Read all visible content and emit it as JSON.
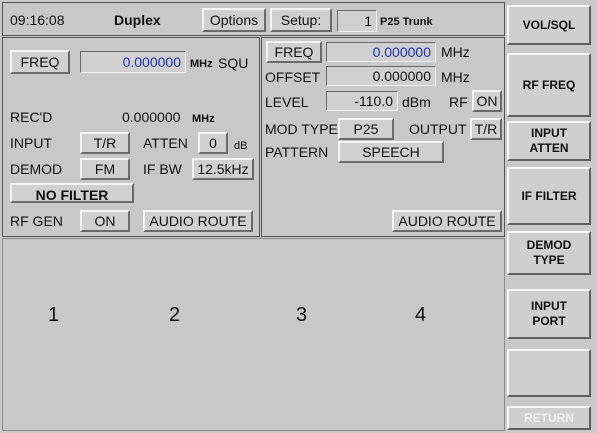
{
  "topbar": {
    "time": "09:16:08",
    "mode": "Duplex",
    "options": "Options",
    "setup_label": "Setup:",
    "setup_index": "1",
    "setup_name": "P25 Trunk"
  },
  "receiver": {
    "freq_button": "FREQ",
    "freq_value": "0.000000",
    "freq_unit": "MHz",
    "squelch": "SQU",
    "recd_label": "REC'D",
    "recd_value": "0.000000",
    "recd_unit": "MHz",
    "input_label": "INPUT",
    "input_value": "T/R",
    "atten_label": "ATTEN",
    "atten_value": "0",
    "atten_unit": "dB",
    "demod_label": "DEMOD",
    "demod_value": "FM",
    "ifbw_label": "IF BW",
    "ifbw_value": "12.5kHz",
    "filter_button": "NO FILTER",
    "rfgen_label": "RF GEN",
    "rfgen_value": "ON",
    "audio_route": "AUDIO ROUTE"
  },
  "generator": {
    "freq_button": "FREQ",
    "freq_value": "0.000000",
    "freq_unit": "MHz",
    "offset_label": "OFFSET",
    "offset_value": "0.000000",
    "offset_unit": "MHz",
    "level_label": "LEVEL",
    "level_value": "-110.0",
    "level_unit": "dBm",
    "rf_label": "RF",
    "rf_value": "ON",
    "modtype_label": "MOD TYPE",
    "modtype_value": "P25",
    "output_label": "OUTPUT",
    "output_value": "T/R",
    "pattern_label": "PATTERN",
    "pattern_value": "SPEECH",
    "audio_route": "AUDIO ROUTE"
  },
  "lower_numbers": [
    "1",
    "2",
    "3",
    "4"
  ],
  "softkeys": [
    {
      "label": "VOL/SQL",
      "enabled": true
    },
    {
      "label": "RF FREQ",
      "enabled": true
    },
    {
      "label": "INPUT\nATTEN",
      "enabled": true
    },
    {
      "label": "IF FILTER",
      "enabled": true
    },
    {
      "label": "DEMOD\nTYPE",
      "enabled": true
    },
    {
      "label": "INPUT\nPORT",
      "enabled": true
    },
    {
      "label": "",
      "enabled": true
    },
    {
      "label": "RETURN",
      "enabled": false
    }
  ],
  "colors": {
    "screen_bg": "#c8c8c8",
    "value_blue": "#1f2fbf",
    "disabled_text": "#f0f0f0"
  }
}
